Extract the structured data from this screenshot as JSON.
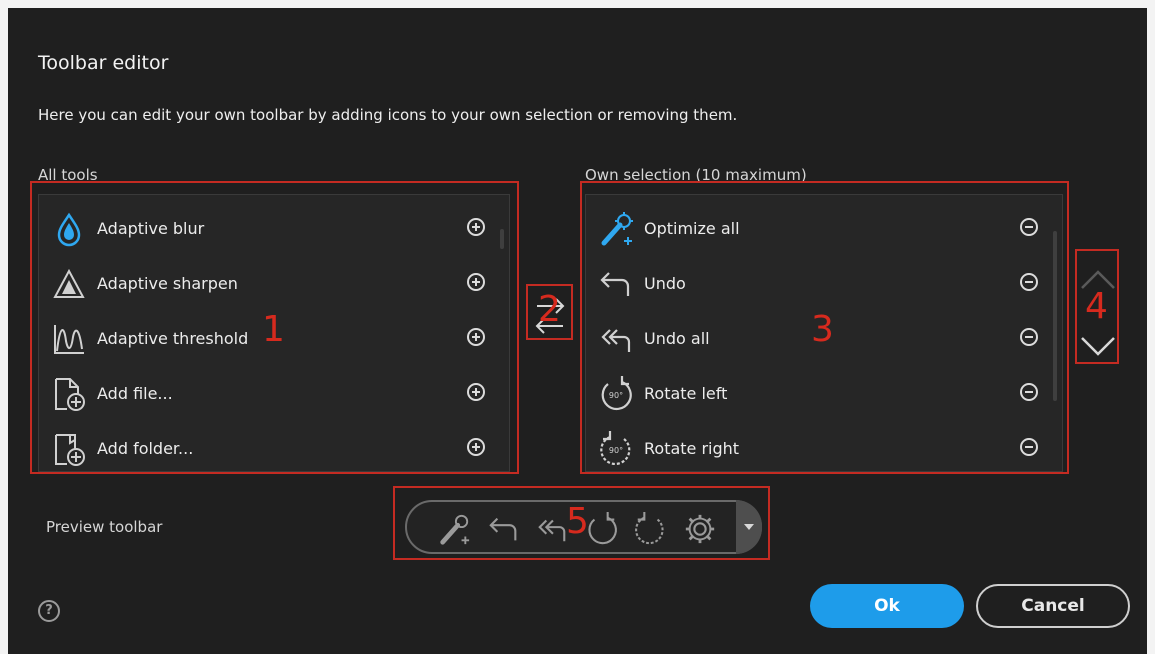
{
  "dialog": {
    "title": "Toolbar editor",
    "description": "Here you can edit your own toolbar by adding icons to your own selection or removing them."
  },
  "all_tools": {
    "label": "All tools",
    "items": [
      {
        "label": "Adaptive blur",
        "icon": "drop-icon"
      },
      {
        "label": "Adaptive sharpen",
        "icon": "triangle-icon"
      },
      {
        "label": "Adaptive threshold",
        "icon": "wave-icon"
      },
      {
        "label": "Add file...",
        "icon": "add-file-icon"
      },
      {
        "label": "Add folder...",
        "icon": "add-folder-icon"
      }
    ]
  },
  "own_selection": {
    "label": "Own selection (10 maximum)",
    "items": [
      {
        "label": "Optimize all",
        "icon": "magic-wand-icon"
      },
      {
        "label": "Undo",
        "icon": "undo-icon"
      },
      {
        "label": "Undo all",
        "icon": "undo-all-icon"
      },
      {
        "label": "Rotate left",
        "icon": "rotate-left-icon"
      },
      {
        "label": "Rotate right",
        "icon": "rotate-right-icon"
      }
    ]
  },
  "rotate_badge": "90°",
  "preview": {
    "label": "Preview toolbar",
    "icons": [
      "magic-wand-icon",
      "undo-icon",
      "undo-all-icon",
      "rotate-left-icon",
      "rotate-right-icon",
      "gear-icon"
    ]
  },
  "annotations": [
    "1",
    "2",
    "3",
    "4",
    "5"
  ],
  "buttons": {
    "ok": "Ok",
    "cancel": "Cancel"
  },
  "help": "?",
  "colors": {
    "accent": "#1e9cea",
    "annotation": "#c42b22",
    "background": "#1f1f1f"
  }
}
